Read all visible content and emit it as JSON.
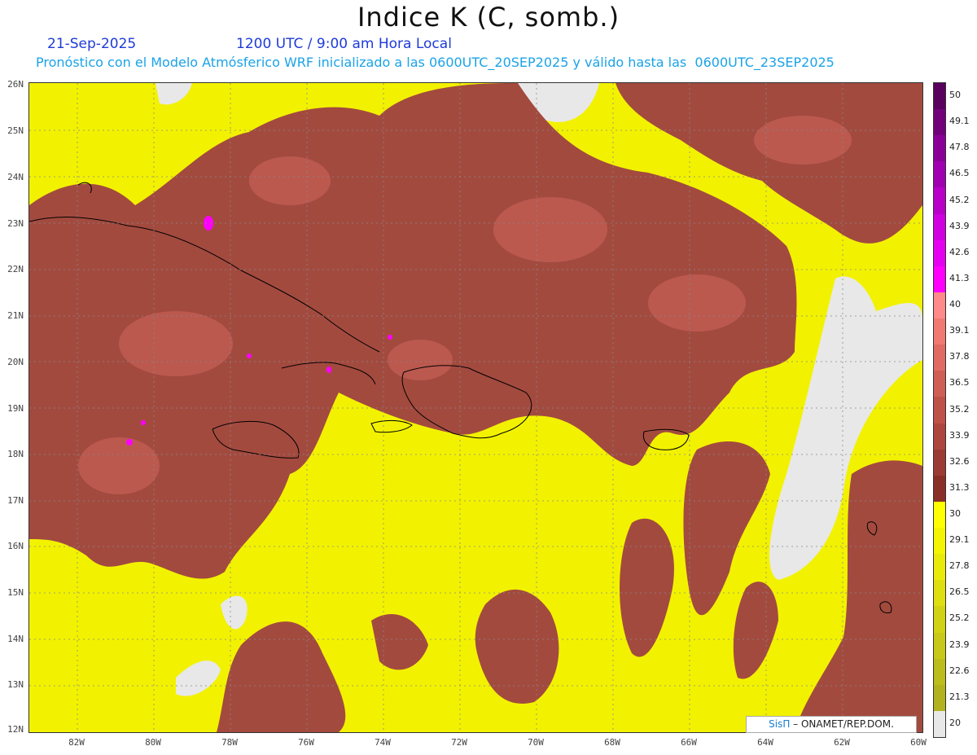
{
  "header": {
    "title": "Indice K (C, somb.)",
    "date": "21-Sep-2025",
    "time": "1200 UTC / 9:00 am Hora Local",
    "forecast": "Pronóstico con el Modelo Atmósferico WRF inicializado a las 0600UTC_20SEP2025 y válido hasta las  0600UTC_23SEP2025"
  },
  "axes": {
    "lat_labels": [
      "26N",
      "25N",
      "24N",
      "23N",
      "22N",
      "21N",
      "20N",
      "19N",
      "18N",
      "17N",
      "16N",
      "15N",
      "14N",
      "13N",
      "12N"
    ],
    "lon_labels": [
      "82W",
      "80W",
      "78W",
      "76W",
      "74W",
      "72W",
      "70W",
      "68W",
      "66W",
      "64W",
      "62W",
      "60W"
    ]
  },
  "colorbar": {
    "labels": [
      "50",
      "49.1",
      "47.8",
      "46.5",
      "45.2",
      "43.9",
      "42.6",
      "41.3",
      "40",
      "39.1",
      "37.8",
      "36.5",
      "35.2",
      "33.9",
      "32.6",
      "31.3",
      "30",
      "29.1",
      "27.8",
      "26.5",
      "25.2",
      "23.9",
      "22.6",
      "21.3",
      "20"
    ],
    "colors": [
      "#5a005e",
      "#72007a",
      "#8a0096",
      "#a000b0",
      "#b800c8",
      "#d000e0",
      "#e600f0",
      "#ff00ff",
      "#ff8a8a",
      "#f07a72",
      "#e06b62",
      "#cf5e55",
      "#be5249",
      "#ad463f",
      "#9c3b34",
      "#8a2f28",
      "#ffff00",
      "#f4f400",
      "#eaea0a",
      "#dede10",
      "#d2d214",
      "#c8c818",
      "#bcbc1c",
      "#b2b220",
      "#e8e8e8"
    ]
  },
  "credit": {
    "brand": "SisΠ",
    "org": "– ONAMET/REP.DOM."
  },
  "colors": {
    "land_outline": "#000000",
    "high_k": "#a34a3f",
    "mid_k": "#ffff00",
    "low_k": "#e8e8e8"
  }
}
